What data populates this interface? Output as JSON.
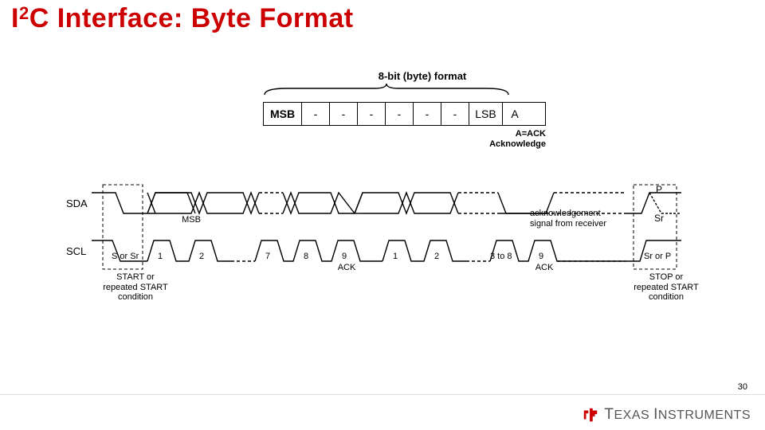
{
  "title": {
    "pre": "I",
    "sup": "2",
    "post": "C Interface: Byte Format"
  },
  "byte": {
    "label": "8-bit (byte) format",
    "cells": {
      "msb": "MSB",
      "d": "-",
      "lsb": "LSB",
      "ack": "A"
    },
    "ack_note_1": "A=ACK",
    "ack_note_2": "Acknowledge"
  },
  "timing": {
    "sda_label": "SDA",
    "scl_label": "SCL",
    "start_caption_top": "S or Sr",
    "start_caption": "START or\nrepeated START\ncondition",
    "stop_caption_top": "Sr or P",
    "stop_caption": "STOP or\nrepeated START\ncondition",
    "ack_label": "ACK",
    "msb_label": "MSB",
    "p_label": "P",
    "sr_label": "Sr",
    "ack_rx": "acknowledgement\nsignal from receiver",
    "scl_nums": [
      "1",
      "2",
      "7",
      "8",
      "9",
      "1",
      "2",
      "3 to 8",
      "9"
    ]
  },
  "footer": {
    "page": "30",
    "brand_a": "T",
    "brand_b": "EXAS ",
    "brand_c": "I",
    "brand_d": "NSTRUMENTS"
  }
}
